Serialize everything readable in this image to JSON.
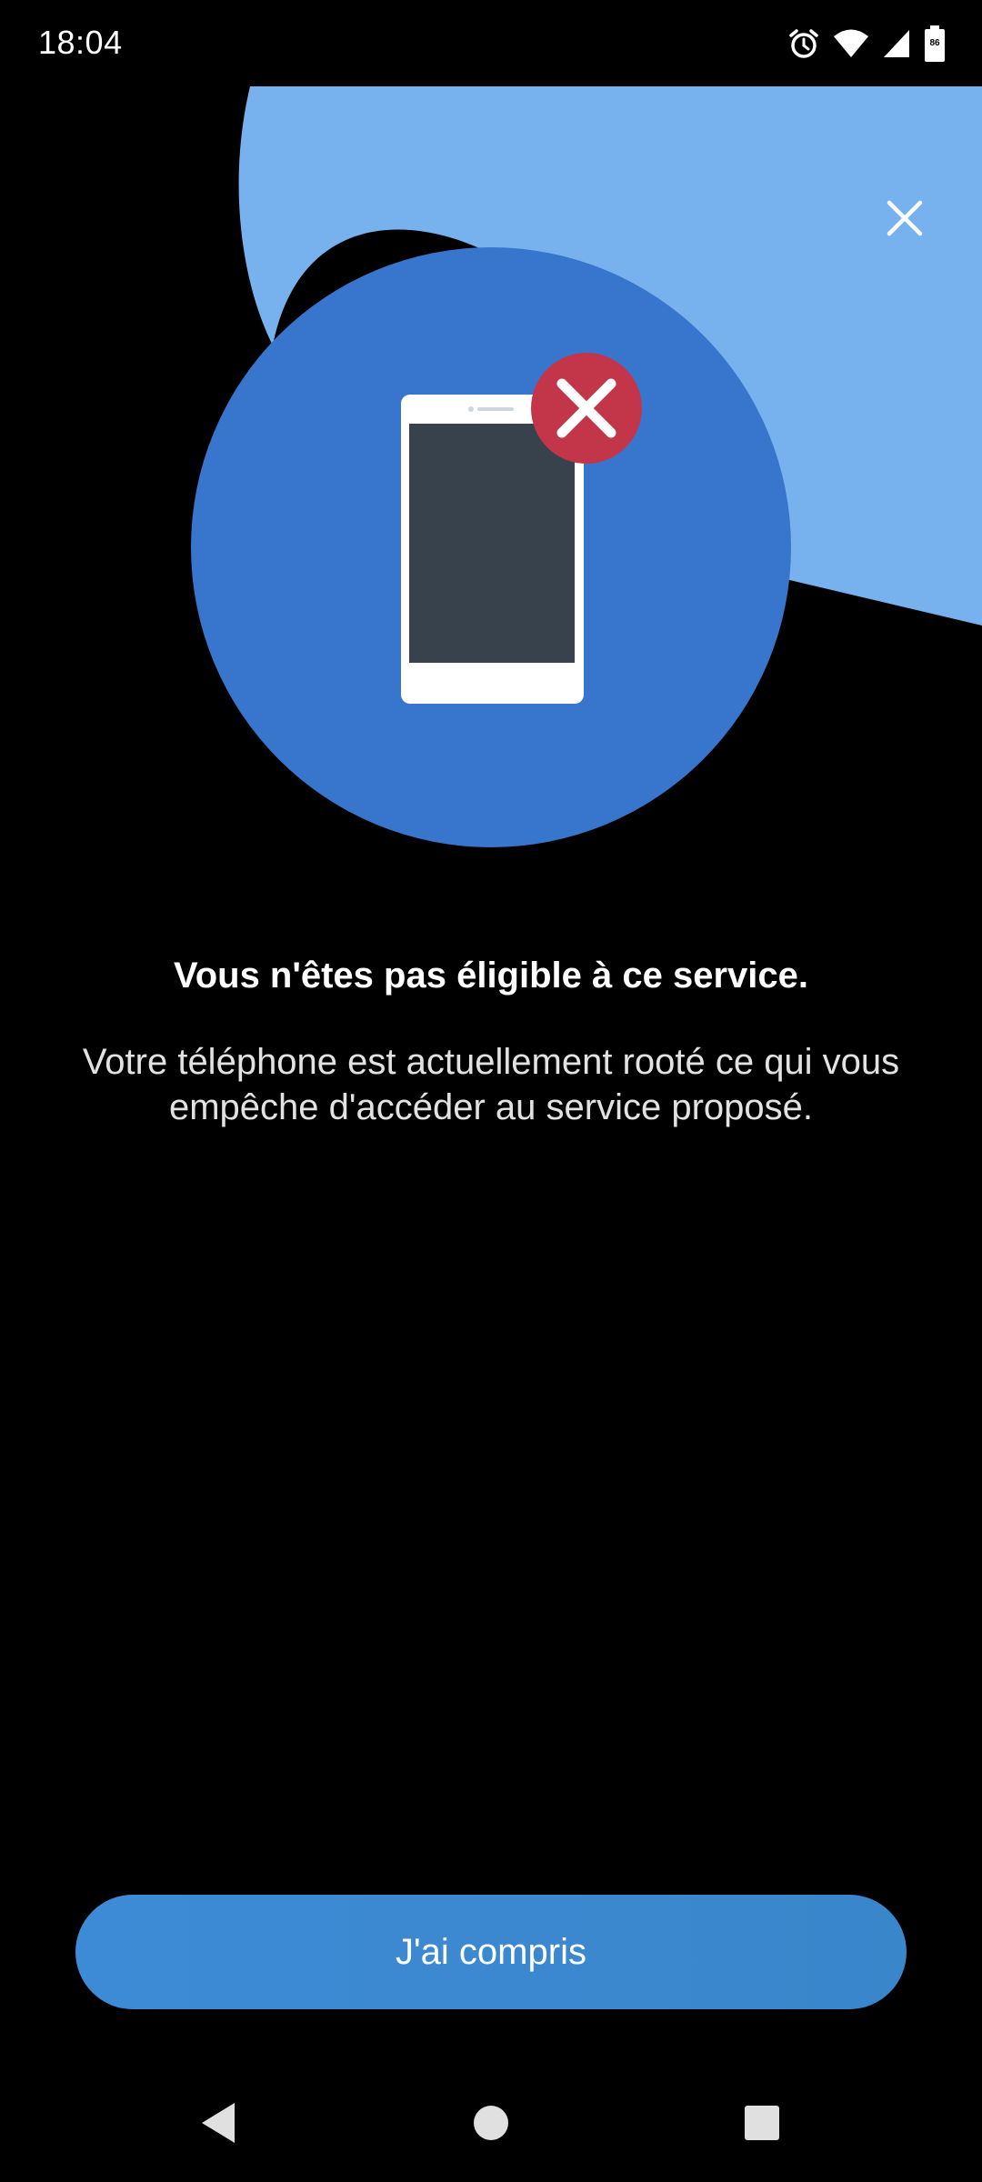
{
  "status_bar": {
    "time": "18:04",
    "battery_level": "86",
    "icons": [
      "alarm-icon",
      "wifi-icon",
      "signal-icon",
      "battery-icon"
    ]
  },
  "hero": {
    "icons": [
      "close-icon",
      "smartphone-icon",
      "error-x-icon"
    ],
    "colors": {
      "light_blue": "#78b2ee",
      "circle_blue": "#3875cc",
      "phone_white": "#ffffff",
      "phone_screen": "#37424d",
      "error_red": "#c33649"
    }
  },
  "message": {
    "title": "Vous n'êtes pas éligible à ce service.",
    "description": "Votre téléphone est actuellement rooté ce qui vous empêche d'accéder au service proposé."
  },
  "actions": {
    "confirm_label": "J'ai compris",
    "accent_color": "#3d8bd6"
  },
  "nav_bar": {
    "icons": [
      "back-icon",
      "home-icon",
      "recents-icon"
    ]
  }
}
